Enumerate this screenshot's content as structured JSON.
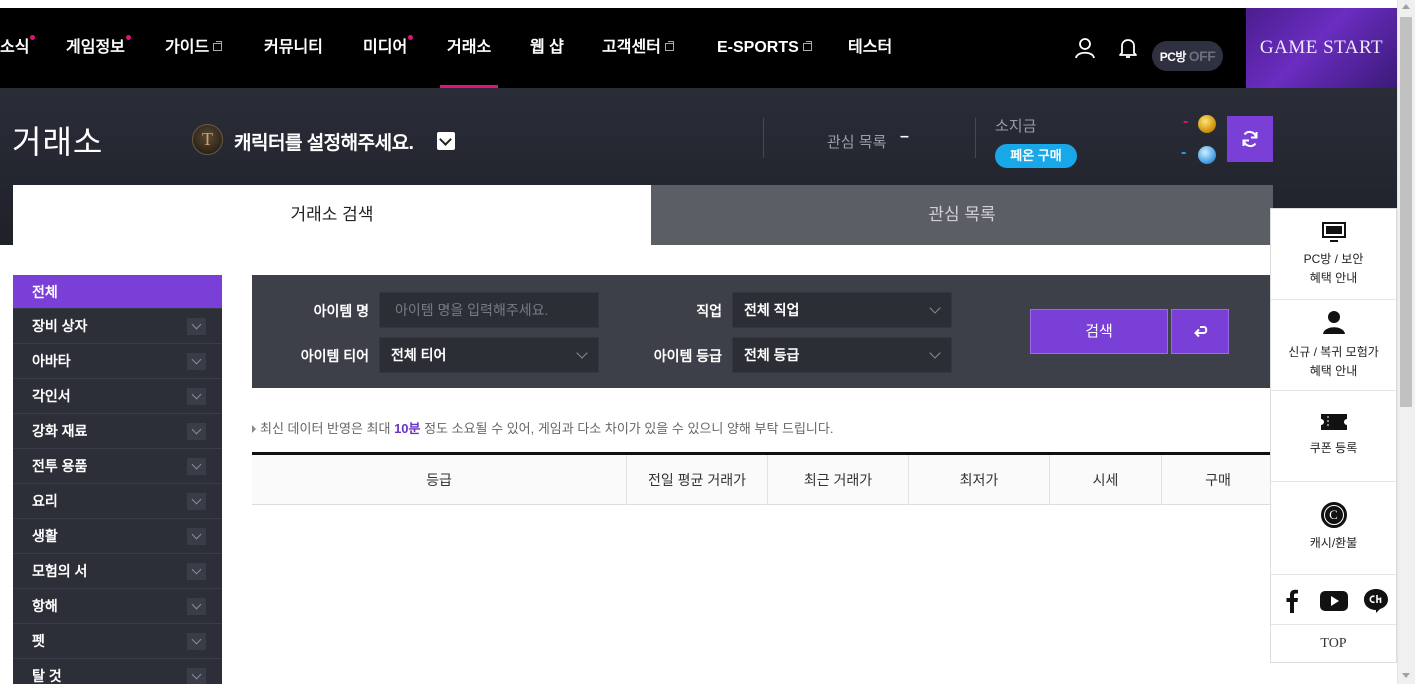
{
  "nav": {
    "items": [
      {
        "label": "소식",
        "dot": true,
        "ext": false
      },
      {
        "label": "게임정보",
        "dot": true,
        "ext": false
      },
      {
        "label": "가이드",
        "dot": false,
        "ext": true
      },
      {
        "label": "커뮤니티",
        "dot": false,
        "ext": false
      },
      {
        "label": "미디어",
        "dot": true,
        "ext": false
      },
      {
        "label": "거래소",
        "dot": false,
        "ext": false,
        "active": true
      },
      {
        "label": "웹 샵",
        "dot": false,
        "ext": false
      },
      {
        "label": "고객센터",
        "dot": false,
        "ext": true
      },
      {
        "label": "E-SPORTS",
        "dot": false,
        "ext": true
      },
      {
        "label": "테스터",
        "dot": false,
        "ext": false
      }
    ],
    "pcbang_label": "PC방",
    "pcbang_state": "OFF",
    "game_start": "GAME START",
    "icons": [
      "user-icon",
      "bell-icon"
    ]
  },
  "header": {
    "title": "거래소",
    "character_prompt": "캐릭터를 설정해주세요.",
    "wishlist_label": "관심 목록",
    "wishlist_count": "–",
    "money_label": "소지금",
    "phoenix_button": "페온 구매",
    "gold_value": "-",
    "blue_value": "-"
  },
  "tabs": [
    {
      "label": "거래소 검색",
      "active": true
    },
    {
      "label": "관심 목록",
      "active": false
    }
  ],
  "sidebar": {
    "items": [
      {
        "label": "전체",
        "active": true
      },
      {
        "label": "장비 상자"
      },
      {
        "label": "아바타"
      },
      {
        "label": "각인서"
      },
      {
        "label": "강화 재료"
      },
      {
        "label": "전투 용품"
      },
      {
        "label": "요리"
      },
      {
        "label": "생활"
      },
      {
        "label": "모험의 서"
      },
      {
        "label": "항해"
      },
      {
        "label": "펫"
      },
      {
        "label": "탈 것"
      }
    ]
  },
  "search": {
    "item_name_label": "아이템 명",
    "item_name_placeholder": "아이템 명을 입력해주세요.",
    "class_label": "직업",
    "class_value": "전체 직업",
    "tier_label": "아이템 티어",
    "tier_value": "전체 티어",
    "grade_label": "아이템 등급",
    "grade_value": "전체 등급",
    "search_button": "검색"
  },
  "notice": {
    "before": "최신 데이터 반영은 최대 ",
    "highlight": "10분",
    "after": " 정도 소요될 수 있어, 게임과 다소 차이가 있을 수 있으니 양해 부탁 드립니다."
  },
  "table": {
    "columns": [
      "등급",
      "전일 평균 거래가",
      "최근 거래가",
      "최저가",
      "시세",
      "구매"
    ]
  },
  "quick_menu": {
    "items": [
      {
        "line1": "PC방 / 보안",
        "line2": "혜택 안내",
        "icon": "monitor-icon"
      },
      {
        "line1": "신규 / 복귀 모험가",
        "line2": "혜택 안내",
        "icon": "person-icon"
      },
      {
        "line1": "쿠폰 등록",
        "line2": "",
        "icon": "ticket-icon"
      },
      {
        "line1": "캐시/환불",
        "line2": "",
        "icon": "cash-icon"
      }
    ],
    "cash_icon_letter": "C",
    "social": [
      "facebook-icon",
      "youtube-icon",
      "channel-icon"
    ],
    "top_label": "TOP"
  },
  "colors": {
    "accent": "#7a3fd6",
    "nav_dot": "#e0127a",
    "phoenix": "#18a7e8"
  }
}
